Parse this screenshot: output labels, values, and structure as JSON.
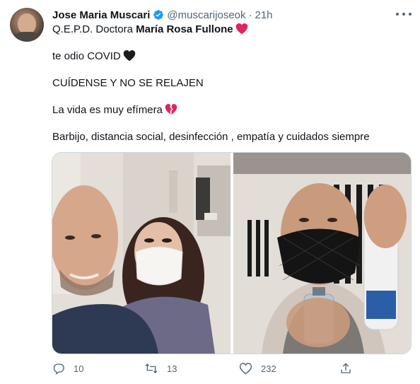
{
  "tweet": {
    "author_name": "Jose Maria Muscari",
    "author_handle": "@muscarijoseok",
    "separator": "·",
    "timestamp": "21h",
    "text": {
      "line1_prefix": "Q.E.P.D. Doctora ",
      "line1_bold": "María Rosa Fullone",
      "line2": "te odio COVID",
      "line3": "CUÍDENSE Y NO SE RELAJEN",
      "line4": "La vida es muy efímera",
      "line5": "Barbijo, distancia social, desinfección , empatía y cuidados siempre"
    },
    "emojis": {
      "line1": "red-heart-icon",
      "line2": "black-heart-icon",
      "line4": "broken-heart-icon"
    },
    "media": [
      {
        "kind": "photo",
        "icon": "selfie-with-masked-doctor"
      },
      {
        "kind": "photo",
        "icon": "man-with-mask-and-sanitizer"
      }
    ],
    "actions": {
      "reply_count": "10",
      "retweet_count": "13",
      "like_count": "232"
    }
  },
  "colors": {
    "text": "#0f1419",
    "secondary": "#536471",
    "verified": "#1d9bf0",
    "heart_red": "#e0245e",
    "border": "#cfd9de"
  }
}
